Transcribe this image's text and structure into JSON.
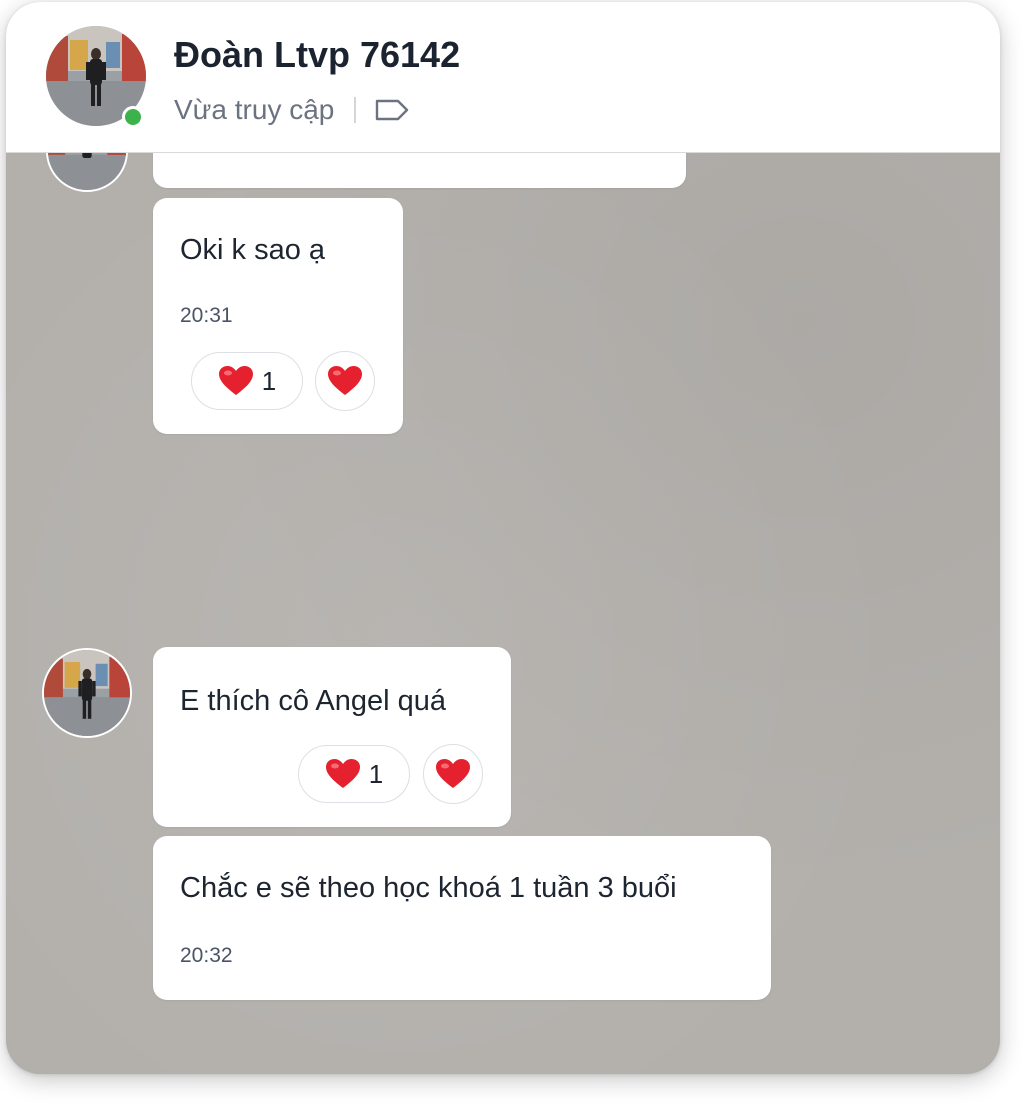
{
  "header": {
    "contact_name": "Đoàn Ltvp 76142",
    "status": "Vừa truy cập",
    "tag_icon": "tag-icon",
    "online": true
  },
  "messages": [
    {
      "text": "Oki k sao ạ",
      "time": "20:31",
      "reaction": {
        "emoji": "heart",
        "count": "1"
      }
    },
    {
      "text": "E thích cô Angel quá",
      "reaction": {
        "emoji": "heart",
        "count": "1"
      }
    },
    {
      "text": "Chắc e sẽ theo học khoá 1 tuần 3 buổi",
      "time": "20:32"
    }
  ],
  "colors": {
    "chat_background": "#b3b0ac",
    "bubble": "#ffffff",
    "online": "#3bb34a",
    "heart": "#e5212f"
  }
}
